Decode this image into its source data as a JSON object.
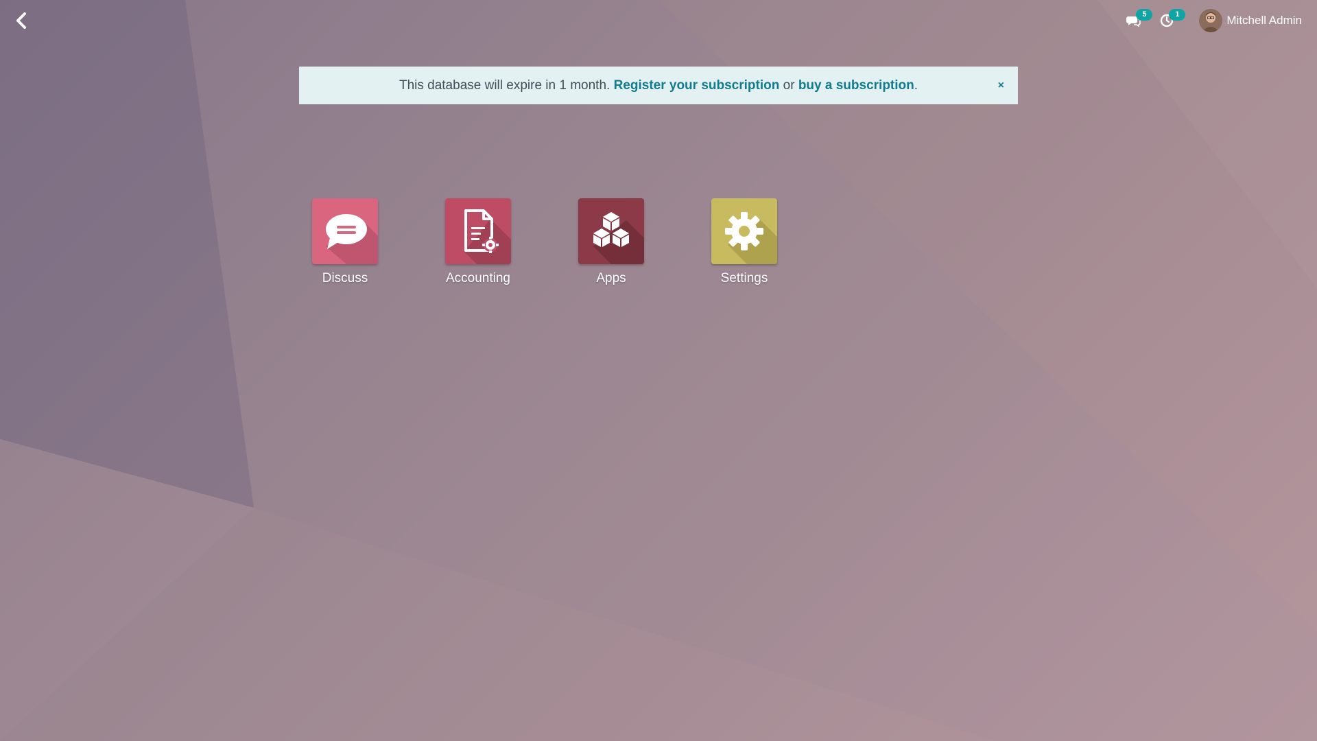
{
  "topbar": {
    "back_icon": "chevron-left-icon",
    "messages": {
      "icon": "chat-icon",
      "count": "5"
    },
    "activities": {
      "icon": "clock-icon",
      "count": "1"
    },
    "user": {
      "name": "Mitchell Admin",
      "avatar_icon": "user-avatar"
    }
  },
  "banner": {
    "text_before": "This database will expire in 1 month.",
    "register_link": "Register your subscription",
    "connector": "or",
    "buy_link": "buy a subscription",
    "end": ".",
    "close": "×"
  },
  "apps": [
    {
      "label": "Discuss",
      "icon": "chat-bubble-icon",
      "color": "#d9657f"
    },
    {
      "label": "Accounting",
      "icon": "document-gear-icon",
      "color": "#bd4c64"
    },
    {
      "label": "Apps",
      "icon": "cubes-icon",
      "color": "#8c3a47"
    },
    {
      "label": "Settings",
      "icon": "gear-icon",
      "color": "#c8bb5f"
    }
  ],
  "colors": {
    "accent": "#137c8c",
    "badge": "#0ea5a4",
    "banner_bg": "#e3f1f3"
  }
}
